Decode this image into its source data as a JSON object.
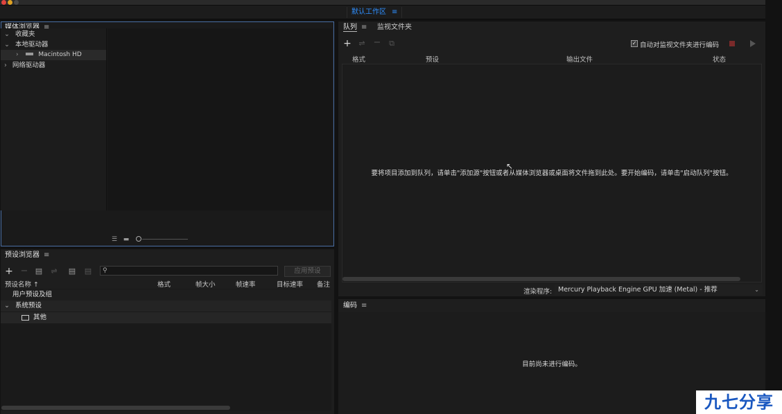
{
  "workspace": {
    "tab_label": "默认工作区"
  },
  "media_browser": {
    "title": "媒体浏览器",
    "search_placeholder": "",
    "tree": {
      "favorites": "收藏夹",
      "local_drives": "本地驱动器",
      "macintosh_hd": "Macintosh HD",
      "network_drives": "网络驱动器"
    }
  },
  "queue": {
    "tabs": [
      "队列",
      "监视文件夹"
    ],
    "auto_encode_label": "自动对监视文件夹进行编码",
    "columns": [
      "格式",
      "预设",
      "输出文件",
      "状态"
    ],
    "empty_message": "要将项目添加到队列，请单击\"添加源\"按钮或者从媒体浏览器或桌面将文件拖到此处。要开始编码，请单击\"启动队列\"按钮。",
    "renderer_label": "渲染程序:",
    "renderer_value": "Mercury Playback Engine GPU 加速 (Metal) - 推荐"
  },
  "encoding": {
    "title": "编码",
    "empty_message": "目前尚未进行编码。"
  },
  "preset_browser": {
    "title": "预设浏览器",
    "apply_button": "应用预设",
    "columns": [
      "预设名称 ↑",
      "格式",
      "帧大小",
      "帧速率",
      "目标速率",
      "备注"
    ],
    "user_group": "用户预设及组",
    "system_group": "系统预设",
    "other_item": "其他"
  },
  "watermark": "九七分享吧"
}
